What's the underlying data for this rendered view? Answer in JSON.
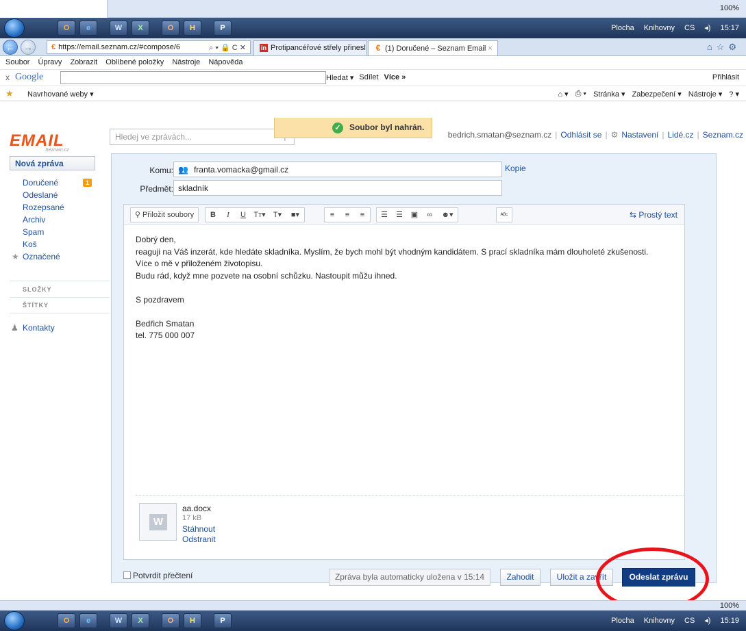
{
  "top_strip": {
    "zoom": "100%"
  },
  "taskbar_top": {
    "apps": [
      "O",
      "e",
      "W",
      "X",
      "O",
      "H",
      "P"
    ],
    "right": {
      "desktop": "Plocha",
      "libraries": "Knihovny",
      "lang": "CS",
      "time": "15:17"
    }
  },
  "browser": {
    "address": "https://email.seznam.cz/#compose/6",
    "address_tools": "⌕ ▾ 🔒 C ✕",
    "tabs": [
      {
        "label": "Protipancéřové střely přinesl n...",
        "fav": "in"
      },
      {
        "label": "(1) Doručené – Seznam Email",
        "fav": "€"
      }
    ],
    "menu": [
      "Soubor",
      "Úpravy",
      "Zobrazit",
      "Oblíbené položky",
      "Nástroje",
      "Nápověda"
    ],
    "google": {
      "logo": "Google",
      "search_btn": "Hledat ▾",
      "share_btn": "Sdílet",
      "more_btn": "Více »",
      "signin": "Přihlásit"
    },
    "favorites": {
      "suggested": "Navrhované weby ▾",
      "cmds": [
        "Stránka ▾",
        "Zabezpečení ▾",
        "Nástroje ▾"
      ]
    }
  },
  "app": {
    "logo_word": "EMAIL",
    "logo_sub": "Seznam.cz",
    "search_placeholder": "Hledej ve zprávách...",
    "toast": "Soubor byl nahrán.",
    "user": {
      "email": "bedrich.smatan@seznam.cz",
      "logout": "Odhlásit se",
      "settings": "Nastavení",
      "people": "Lidé.cz",
      "seznam": "Seznam.cz"
    },
    "sidebar": {
      "new_mail": "Nová zpráva",
      "folders": [
        {
          "label": "Doručené",
          "count": "1"
        },
        {
          "label": "Odeslané"
        },
        {
          "label": "Rozepsané"
        },
        {
          "label": "Archiv"
        },
        {
          "label": "Spam"
        },
        {
          "label": "Koš"
        },
        {
          "label": "Označené"
        }
      ],
      "folders_head": "SLOŽKY",
      "labels_head": "ŠTÍTKY",
      "contacts": "Kontakty"
    },
    "compose": {
      "to_label": "Komu:",
      "to_value": "franta.vomacka@gmail.cz",
      "copy_label": "Kopie",
      "subject_label": "Předmět:",
      "subject_value": "skladník",
      "toolbar": {
        "attach": "Přiložit soubory",
        "plain": "Prostý text"
      },
      "body": [
        "Dobrý den,",
        "reaguji na Váš inzerát, kde hledáte skladníka. Myslím, že bych mohl být vhodným kandidátem. S prací skladníka mám dlouholeté zkušenosti.",
        "Více o mě v přiloženém životopisu.",
        "Budu rád, když mne pozvete na osobní schůzku. Nastoupit můžu ihned.",
        "",
        "S pozdravem",
        "",
        "Bedřich Smatan",
        "tel. 775 000 007"
      ],
      "attachment": {
        "name": "aa.docx",
        "size": "17 kB",
        "download": "Stáhnout",
        "remove": "Odstranit"
      },
      "confirm_read": "Potvrdit přečtení",
      "autosave": "Zpráva byla automaticky uložena v 15:14",
      "discard": "Zahodit",
      "save_close": "Uložit a zavřít",
      "send": "Odeslat zprávu"
    }
  },
  "statusbar": {
    "zoom": "100%"
  },
  "taskbar_bottom": {
    "right": {
      "desktop": "Plocha",
      "libraries": "Knihovny",
      "lang": "CS",
      "time": "15:19"
    }
  }
}
